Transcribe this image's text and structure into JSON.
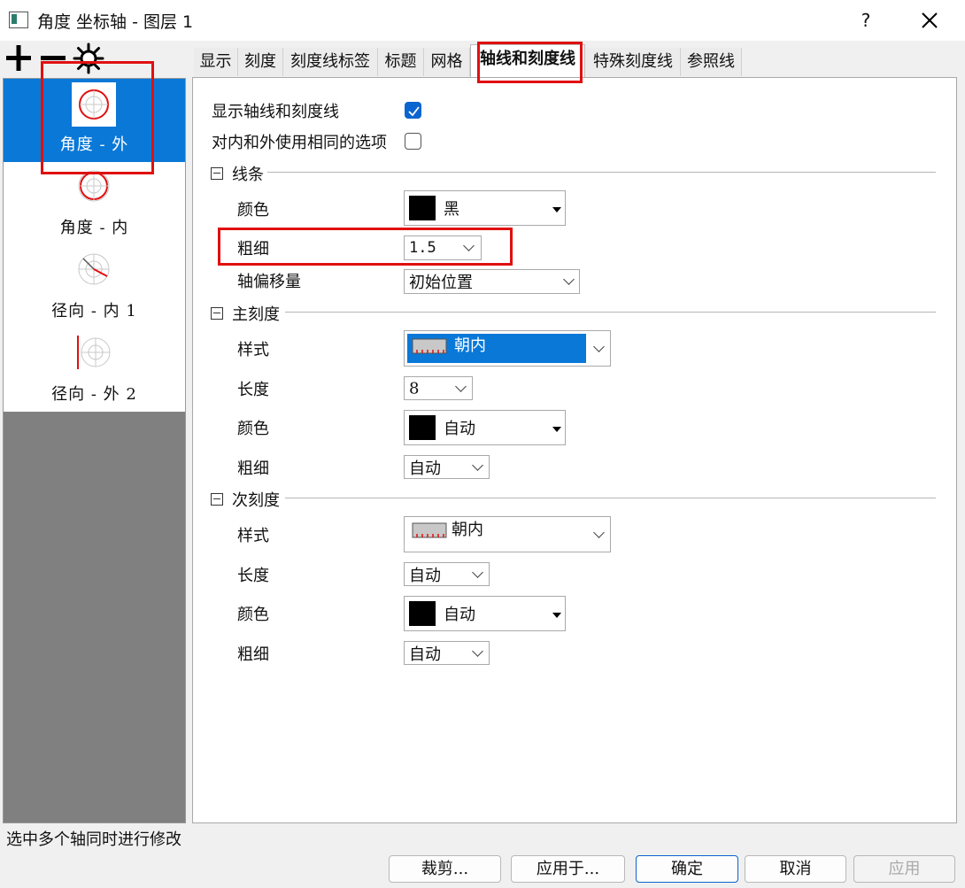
{
  "window": {
    "title": "角度 坐标轴 - 图层 1",
    "help_label": "?"
  },
  "toolbar": {
    "add": "+",
    "remove": "−"
  },
  "axis_list": [
    {
      "label": "角度 - 外",
      "selected": true
    },
    {
      "label": "角度 - 内",
      "selected": false
    },
    {
      "label": "径向 - 内 1",
      "selected": false
    },
    {
      "label": "径向 - 外 2",
      "selected": false
    }
  ],
  "tabs": [
    {
      "label": "显示"
    },
    {
      "label": "刻度"
    },
    {
      "label": "刻度线标签"
    },
    {
      "label": "标题"
    },
    {
      "label": "网格"
    },
    {
      "label": "轴线和刻度线",
      "active": true
    },
    {
      "label": "特殊刻度线"
    },
    {
      "label": "参照线"
    }
  ],
  "options": {
    "show_axis_ticks": {
      "label": "显示轴线和刻度线",
      "checked": true
    },
    "same_inner_outer": {
      "label": "对内和外使用相同的选项",
      "checked": false
    }
  },
  "line_section": {
    "title": "线条",
    "color_label": "颜色",
    "color_value": "黑",
    "thickness_label": "粗细",
    "thickness_value": "1.5",
    "offset_label": "轴偏移量",
    "offset_value": "初始位置"
  },
  "major_section": {
    "title": "主刻度",
    "style_label": "样式",
    "style_value": "朝内",
    "length_label": "长度",
    "length_value": "8",
    "color_label": "颜色",
    "color_value": "自动",
    "thickness_label": "粗细",
    "thickness_value": "自动"
  },
  "minor_section": {
    "title": "次刻度",
    "style_label": "样式",
    "style_value": "朝内",
    "length_label": "长度",
    "length_value": "自动",
    "color_label": "颜色",
    "color_value": "自动",
    "thickness_label": "粗细",
    "thickness_value": "自动"
  },
  "footer": {
    "hint": "选中多个轴同时进行修改",
    "buttons": {
      "crop": "裁剪...",
      "apply_to": "应用于...",
      "ok": "确定",
      "cancel": "取消",
      "apply": "应用"
    }
  },
  "colors": {
    "accent": "#0a78d7",
    "highlight": "#e01010"
  }
}
